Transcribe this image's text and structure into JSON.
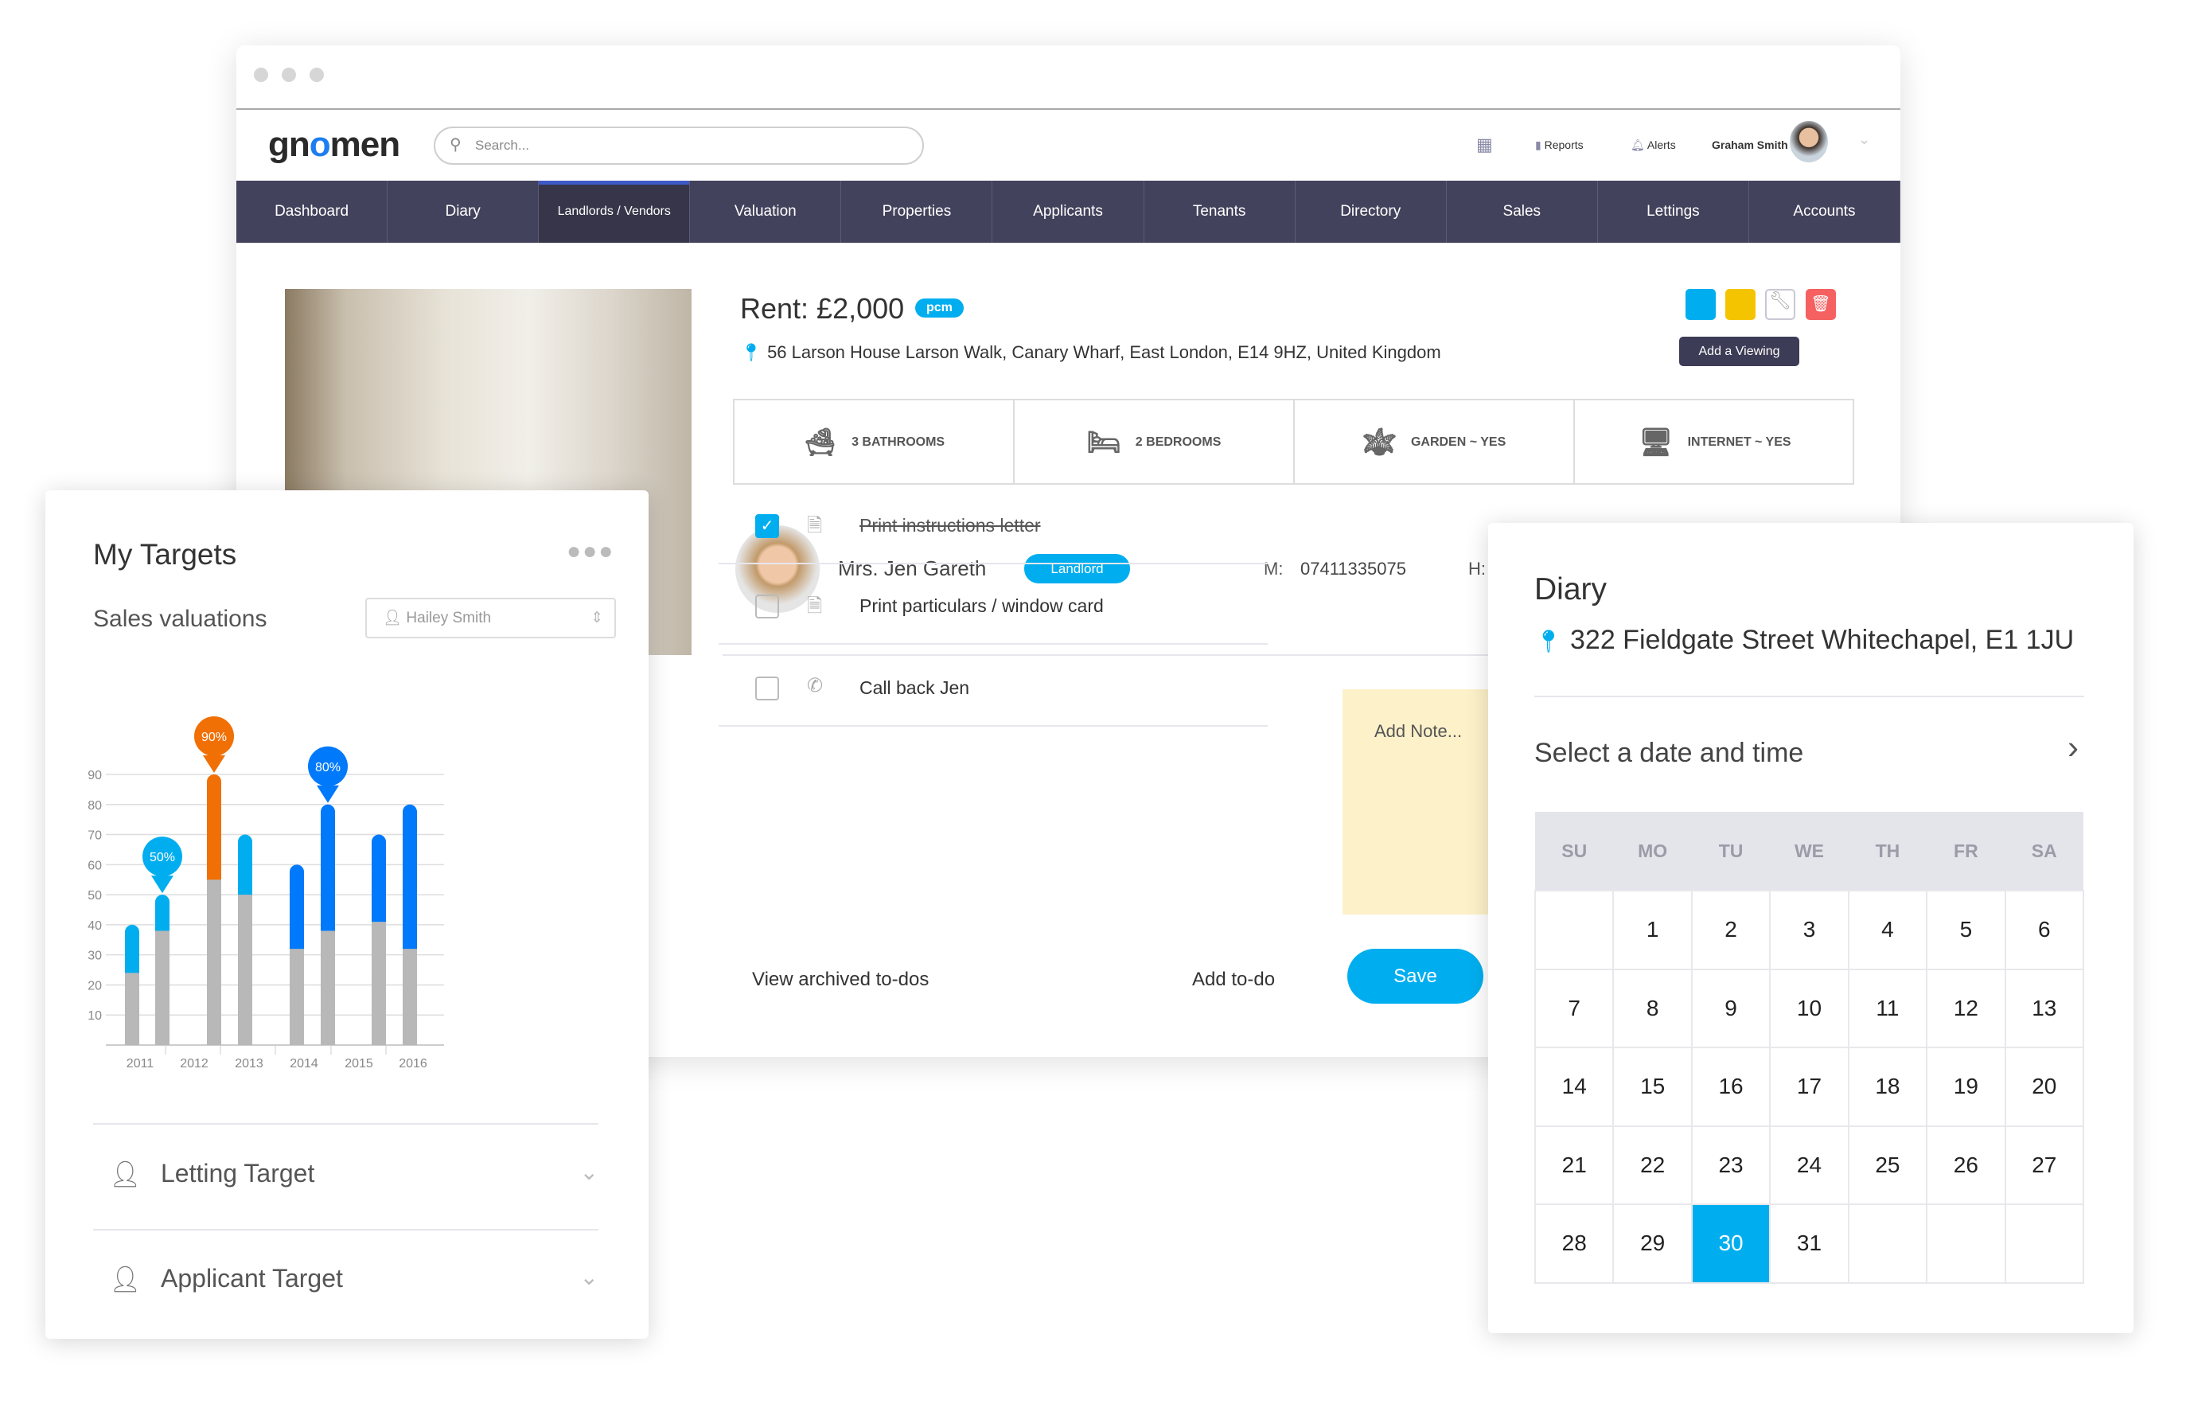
{
  "app": {
    "logo": "gnomen",
    "search_placeholder": "Search...",
    "reports": "Reports",
    "alerts": "Alerts",
    "user": "Graham Smith"
  },
  "nav": [
    "Dashboard",
    "Diary",
    "Landlords / Vendors",
    "Valuation",
    "Properties",
    "Applicants",
    "Tenants",
    "Directory",
    "Sales",
    "Lettings",
    "Accounts"
  ],
  "nav_active": "Landlords / Vendors",
  "property": {
    "rent": "Rent: £2,000",
    "badge": "pcm",
    "address": "56 Larson House Larson Walk, Canary Wharf, East London, E14 9HZ, United Kingdom",
    "tooltip": "Add a Viewing",
    "features": [
      {
        "icon": "bathtub-icon",
        "label": "3 BATHROOMS"
      },
      {
        "icon": "bed-icon",
        "label": "2 BEDROOMS"
      },
      {
        "icon": "plant-icon",
        "label": "GARDEN ~ YES"
      },
      {
        "icon": "monitor-icon",
        "label": "INTERNET ~ YES"
      }
    ]
  },
  "contact": {
    "name": "Mrs. Jen Gareth",
    "role": "Landlord",
    "m_label": "M:",
    "mobile": "07411335075",
    "h_label": "H:"
  },
  "todos": [
    {
      "text": "Print instructions letter",
      "done": true,
      "icon": "document-icon"
    },
    {
      "text": "Print particulars / window card",
      "done": false,
      "icon": "document-icon"
    },
    {
      "text": "Call back Jen",
      "done": false,
      "icon": "phone-icon"
    }
  ],
  "note_placeholder": "Add Note...",
  "footer": {
    "archived": "View archived to-dos",
    "add": "Add to-do",
    "save": "Save"
  },
  "targets": {
    "title": "My Targets",
    "subtitle": "Sales valuations",
    "person": "Hailey Smith",
    "sections": [
      "Letting Target",
      "Applicant Target"
    ]
  },
  "chart_data": {
    "type": "bar",
    "stacked": true,
    "categories": [
      "2011",
      "2012",
      "2013",
      "2014",
      "2015",
      "2016"
    ],
    "ylim": [
      0,
      90
    ],
    "yticks": [
      10,
      20,
      30,
      40,
      50,
      60,
      70,
      80,
      90
    ],
    "grid": true,
    "bars": [
      {
        "base": 24,
        "total": 40,
        "color": "#00aeef"
      },
      {
        "base": 38,
        "total": 50,
        "color": "#00aeef",
        "label": "50%"
      },
      {
        "base": 55,
        "total": 90,
        "color": "#f07005",
        "label": "90%"
      },
      {
        "base": 50,
        "total": 70,
        "color": "#00aeef"
      },
      {
        "base": 32,
        "total": 60,
        "color": "#0079fa"
      },
      {
        "base": 38,
        "total": 80,
        "color": "#0079fa",
        "label": "80%"
      },
      {
        "base": 41,
        "total": 70,
        "color": "#0079fa"
      },
      {
        "base": 32,
        "total": 80,
        "color": "#0079fa"
      }
    ]
  },
  "diary": {
    "title": "Diary",
    "address": "322 Fieldgate Street Whitechapel, E1 1JU",
    "select": "Select a date and time",
    "weekdays": [
      "SU",
      "MO",
      "TU",
      "WE",
      "TH",
      "FR",
      "SA"
    ],
    "first_offset": 1,
    "days": 31,
    "selected": 30
  },
  "colors": {
    "nav": "#43425c",
    "accent": "#00aeef",
    "blue": "#0079fa",
    "orange": "#f07005"
  }
}
